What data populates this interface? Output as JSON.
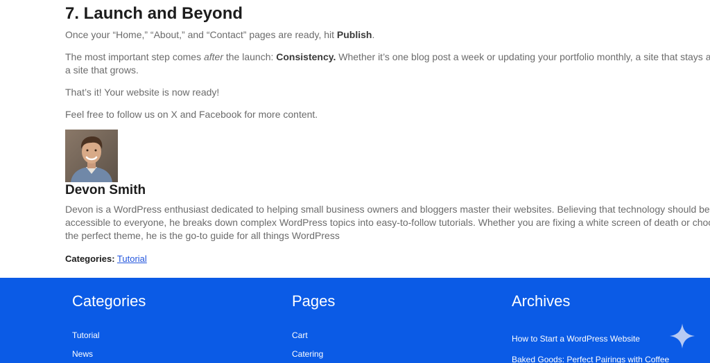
{
  "article": {
    "heading": "7. Launch and Beyond",
    "p1": {
      "before": "Once your “Home,” “About,” and “Contact” pages are ready, hit ",
      "bold": "Publish",
      "after": "."
    },
    "p2": {
      "part1": "The most important step comes ",
      "em": "after",
      "part2": " the launch: ",
      "bold": "Consistency.",
      "line1_rest": " Whether it’s one blog post a week or updating your portfolio monthly, a site that stays active",
      "line2": "a site that grows."
    },
    "p3": "That’s it! Your website is now ready!",
    "p4": "Feel free to follow us on X and Facebook for more content."
  },
  "author": {
    "name": "Devon Smith",
    "bio_lines": [
      "Devon is a WordPress enthusiast dedicated to helping small business owners and bloggers master their websites. Believing that technology should be",
      "accessible to everyone, he breaks down complex WordPress topics into easy-to-follow tutorials. Whether you are fixing a white screen of death or choosing",
      "the perfect theme, he is the go-to guide for all things WordPress"
    ]
  },
  "post_categories": {
    "label": "Categories:",
    "link": "Tutorial"
  },
  "footer": {
    "categories": {
      "title": "Categories",
      "items": [
        "Tutorial",
        "News"
      ]
    },
    "pages": {
      "title": "Pages",
      "items": [
        "Cart",
        "Catering"
      ]
    },
    "archives": {
      "title": "Archives",
      "items": [
        "How to Start a WordPress Website",
        "Baked Goods: Perfect Pairings with Coffee"
      ]
    }
  },
  "colors": {
    "footer_bg": "#0b5be6",
    "link": "#2255dd",
    "heading": "#1c1c1c",
    "body_text": "#6b6b6b"
  },
  "icons": {
    "sparkle": "sparkle-icon"
  }
}
